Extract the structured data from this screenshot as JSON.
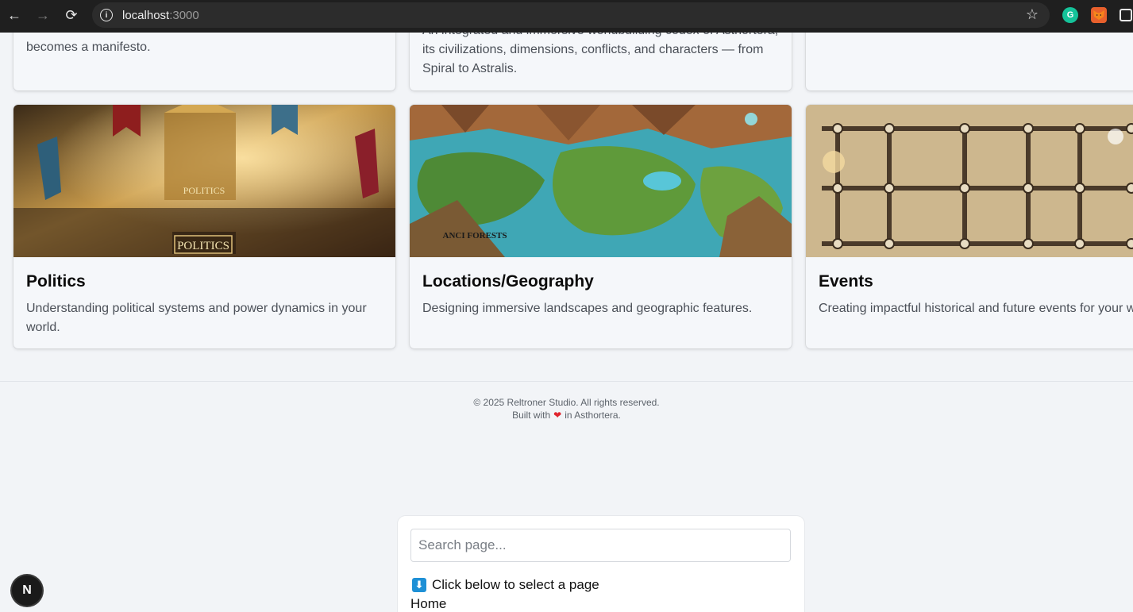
{
  "browser": {
    "url_host": "localhost",
    "url_port": ":3000",
    "back_icon": "←",
    "forward_icon": "→",
    "reload_icon": "⟳",
    "bookmark_icon": "☆",
    "extensions": [
      {
        "name": "grammarly",
        "glyph": "G"
      },
      {
        "name": "metamask",
        "glyph": "🦊"
      },
      {
        "name": "extensions",
        "glyph": ""
      }
    ]
  },
  "cards_top": [
    {
      "desc": "becomes a manifesto."
    },
    {
      "desc": "An integrated and immersive worldbuilding codex of Asthortera, its civilizations, dimensions, conflicts, and characters — from Spiral to Astralis."
    },
    {
      "desc": ""
    }
  ],
  "cards": [
    {
      "title": "Politics",
      "desc": "Understanding political systems and power dynamics in your world.",
      "image_label_1": "POLITICS",
      "image_label_2": "POLITICS"
    },
    {
      "title": "Locations/Geography",
      "desc": "Designing immersive landscapes and geographic features.",
      "image_label": "ANCI FORESTS"
    },
    {
      "title": "Events",
      "desc": "Creating impactful historical and future events for your world."
    }
  ],
  "footer": {
    "copyright": "© 2025 Reltroner Studio. All rights reserved.",
    "built_prefix": "Built with",
    "built_suffix": "in Asthortera."
  },
  "search_panel": {
    "placeholder": "Search page...",
    "hint_icon": "⬇",
    "hint": "Click below to select a page",
    "first_item": "Home"
  },
  "next_indicator": "N"
}
